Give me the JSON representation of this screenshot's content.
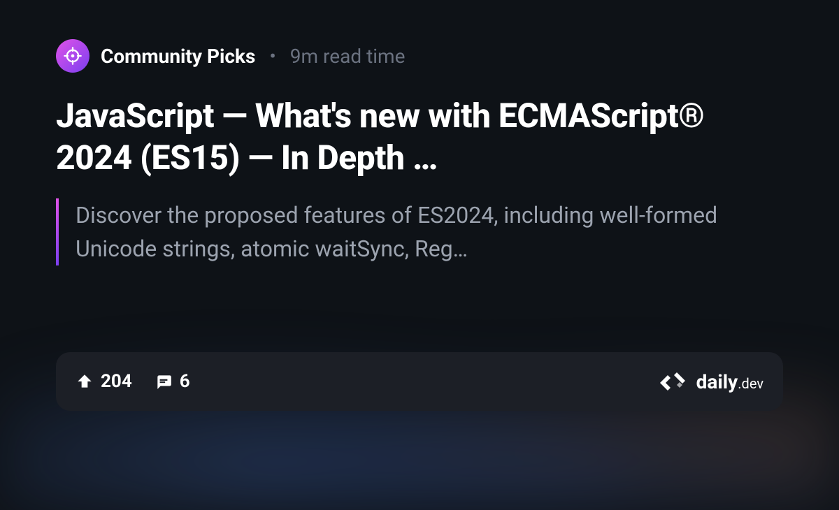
{
  "source": {
    "name": "Community Picks",
    "readTime": "9m read time"
  },
  "article": {
    "title": "JavaScript — What's new with ECMAScript® 2024 (ES15) — In Depth …",
    "description": "Discover the proposed features of ES2024, including well-formed Unicode strings, atomic waitSync, Reg…"
  },
  "stats": {
    "upvotes": "204",
    "comments": "6"
  },
  "brand": {
    "name": "daily",
    "suffix": ".dev"
  }
}
